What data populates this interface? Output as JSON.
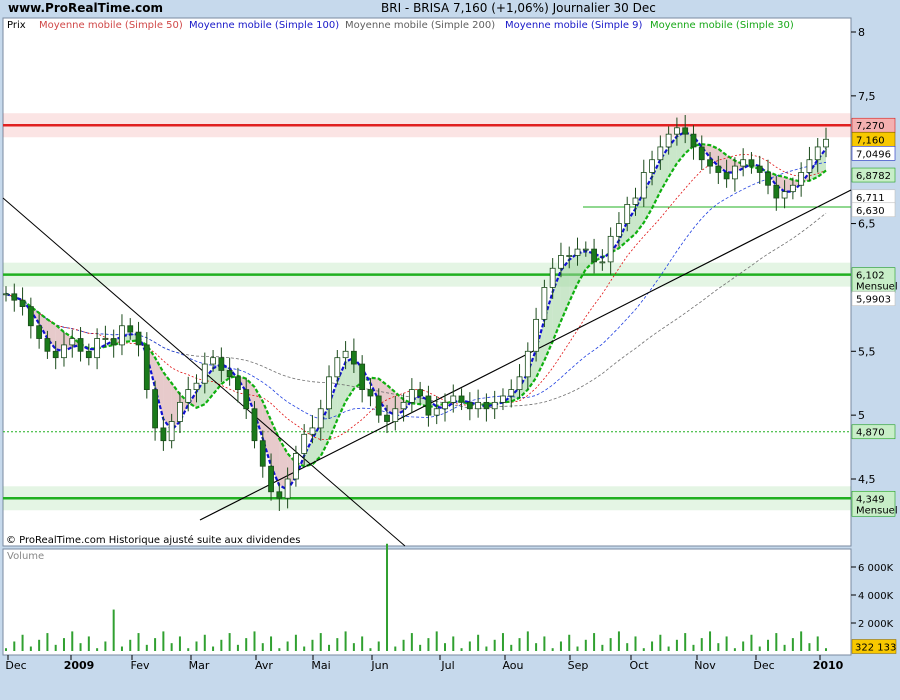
{
  "header": {
    "site": "www.ProRealTime.com",
    "title": "BRI - BRISA   7,160 (+1,06%)   Journalier  30 Dec"
  },
  "price_panel": {
    "label": "Prix",
    "legend": [
      {
        "text": "Moyenne mobile (Simple 50)",
        "color": "#d04848"
      },
      {
        "text": "Moyenne mobile (Simple 100)",
        "color": "#1818c8"
      },
      {
        "text": "Moyenne mobile (Simple 200)",
        "color": "#606060"
      },
      {
        "text": "Moyenne mobile (Simple 9)",
        "color": "#1818c8"
      },
      {
        "text": "Moyenne mobile (Simple 30)",
        "color": "#18a818"
      }
    ],
    "footnote": "© ProRealTime.com Historique ajusté suite aux dividendes"
  },
  "volume_panel": {
    "label": "Volume"
  },
  "colors": {
    "red_level": "#e02020",
    "green_level": "#20b020",
    "candle_body": "#1a7a1a",
    "ma9": "#1010d0",
    "ma30": "#10b010",
    "ma50": "#e01010",
    "ma100": "#2040e0",
    "ma200": "#707070"
  },
  "chart_data": {
    "type": "candlestick",
    "y_ticks": [
      "8",
      "7,5",
      "6,5",
      "5,5",
      "5",
      "4,5"
    ],
    "y_tick_values": [
      8,
      7.5,
      6.5,
      5.5,
      5,
      4.5
    ],
    "x_months": [
      "Dec",
      "2009",
      "Fev",
      "Mar",
      "Avr",
      "Mai",
      "Jun",
      "Jul",
      "Aou",
      "Sep",
      "Oct",
      "Nov",
      "Dec",
      "2010"
    ],
    "ylim": [
      4.0,
      8.05
    ],
    "price_labels": [
      {
        "text": "7,270",
        "value": 7.27,
        "style": "red"
      },
      {
        "text": "7,160",
        "value": 7.16,
        "style": "yellow"
      },
      {
        "text": "7,0496",
        "value": 7.05,
        "style": "blue"
      },
      {
        "text": "6,8782",
        "value": 6.88,
        "style": "green"
      },
      {
        "text": "6,711",
        "value": 6.71,
        "style": "plain"
      },
      {
        "text": "6,630",
        "value": 6.63,
        "style": "plain"
      },
      {
        "text": "6,102",
        "value": 6.1,
        "style": "green",
        "sub": "Mensuel"
      },
      {
        "text": "5,9903",
        "value": 5.99,
        "style": "plain"
      },
      {
        "text": "4,870",
        "value": 4.87,
        "style": "green"
      },
      {
        "text": "4,349",
        "value": 4.349,
        "style": "green",
        "sub": "Mensuel"
      }
    ],
    "horizontal_levels": [
      {
        "value": 7.27,
        "color": "red",
        "style": "thick"
      },
      {
        "value": 6.1,
        "color": "green",
        "style": "thick"
      },
      {
        "value": 4.87,
        "color": "green",
        "style": "dotted"
      },
      {
        "value": 4.349,
        "color": "green",
        "style": "thick"
      },
      {
        "value": 6.63,
        "color": "green",
        "style": "thin-partial"
      }
    ],
    "volume_ticks": [
      "6 000K",
      "4 000K",
      "2 000K"
    ],
    "volume_tick_values": [
      6000,
      4000,
      2000
    ],
    "volume_last": {
      "text": "322 133",
      "value": 322
    },
    "volume_max": 7000,
    "close_approx": [
      5.95,
      5.9,
      5.85,
      5.7,
      5.6,
      5.5,
      5.45,
      5.55,
      5.6,
      5.5,
      5.45,
      5.6,
      5.6,
      5.55,
      5.7,
      5.65,
      5.55,
      5.2,
      4.9,
      4.8,
      4.95,
      5.1,
      5.2,
      5.25,
      5.4,
      5.45,
      5.35,
      5.3,
      5.2,
      5.05,
      4.8,
      4.6,
      4.4,
      4.35,
      4.5,
      4.7,
      4.85,
      4.9,
      5.05,
      5.3,
      5.45,
      5.5,
      5.4,
      5.2,
      5.15,
      5.0,
      4.95,
      5.05,
      5.1,
      5.2,
      5.15,
      5.0,
      5.05,
      5.1,
      5.15,
      5.1,
      5.05,
      5.1,
      5.05,
      5.1,
      5.15,
      5.2,
      5.3,
      5.5,
      5.75,
      6.0,
      6.15,
      6.25,
      6.25,
      6.3,
      6.3,
      6.2,
      6.2,
      6.4,
      6.5,
      6.65,
      6.7,
      6.9,
      7.0,
      7.1,
      7.2,
      7.25,
      7.2,
      7.1,
      7.0,
      6.95,
      6.9,
      6.85,
      6.95,
      7.0,
      6.95,
      6.9,
      6.8,
      6.7,
      6.75,
      6.8,
      6.9,
      7.0,
      7.1,
      7.16
    ]
  }
}
